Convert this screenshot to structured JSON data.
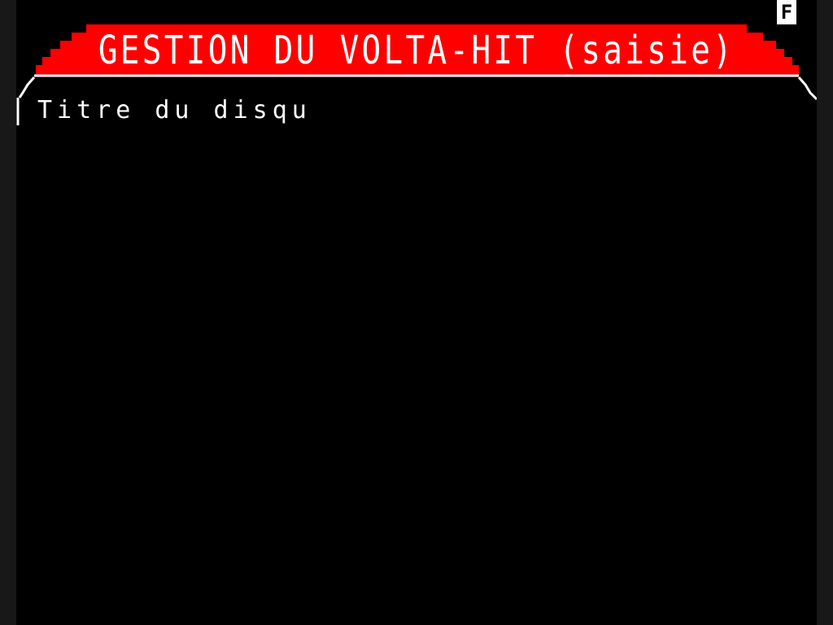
{
  "header": {
    "title": "GESTION DU VOLTA-HIT (saisie)",
    "status_indicator": "F"
  },
  "form": {
    "field_label": "Titre du disqu"
  },
  "colors": {
    "banner": "#ff0000",
    "background": "#000000",
    "text": "#ffffff"
  }
}
